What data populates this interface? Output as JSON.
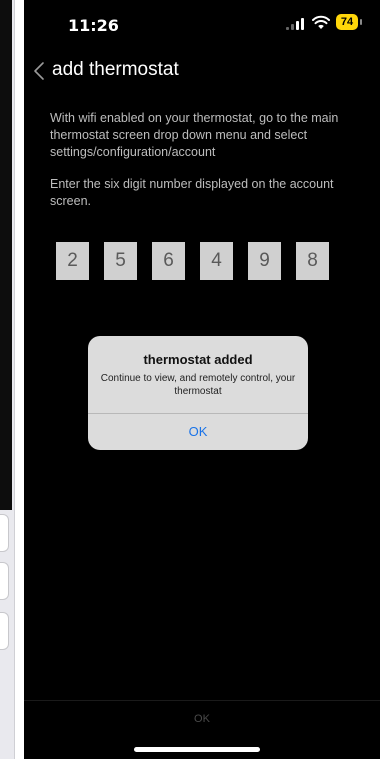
{
  "status_bar": {
    "time": "11:26",
    "battery_level": "74",
    "icons": [
      "signal-icon",
      "wifi-icon",
      "battery-icon"
    ]
  },
  "nav": {
    "back_icon": "chevron-left-icon",
    "title": "add thermostat"
  },
  "instructions": {
    "line1": "With wifi enabled on your thermostat,  go to the main thermostat screen drop down menu and select settings/configuration/account",
    "line2": "Enter the six digit number displayed on the account screen."
  },
  "code_digits": [
    "2",
    "5",
    "6",
    "4",
    "9",
    "8"
  ],
  "alert": {
    "title": "thermostat added",
    "message": "Continue to view, and remotely control, your thermostat",
    "ok_label": "OK"
  },
  "bottom_bar": {
    "ok_label": "OK"
  },
  "colors": {
    "background": "#000000",
    "battery": "#ffd60a",
    "alert_background": "#dcdcdc",
    "alert_button": "#1a73e8",
    "code_box": "#d0d0d0"
  }
}
